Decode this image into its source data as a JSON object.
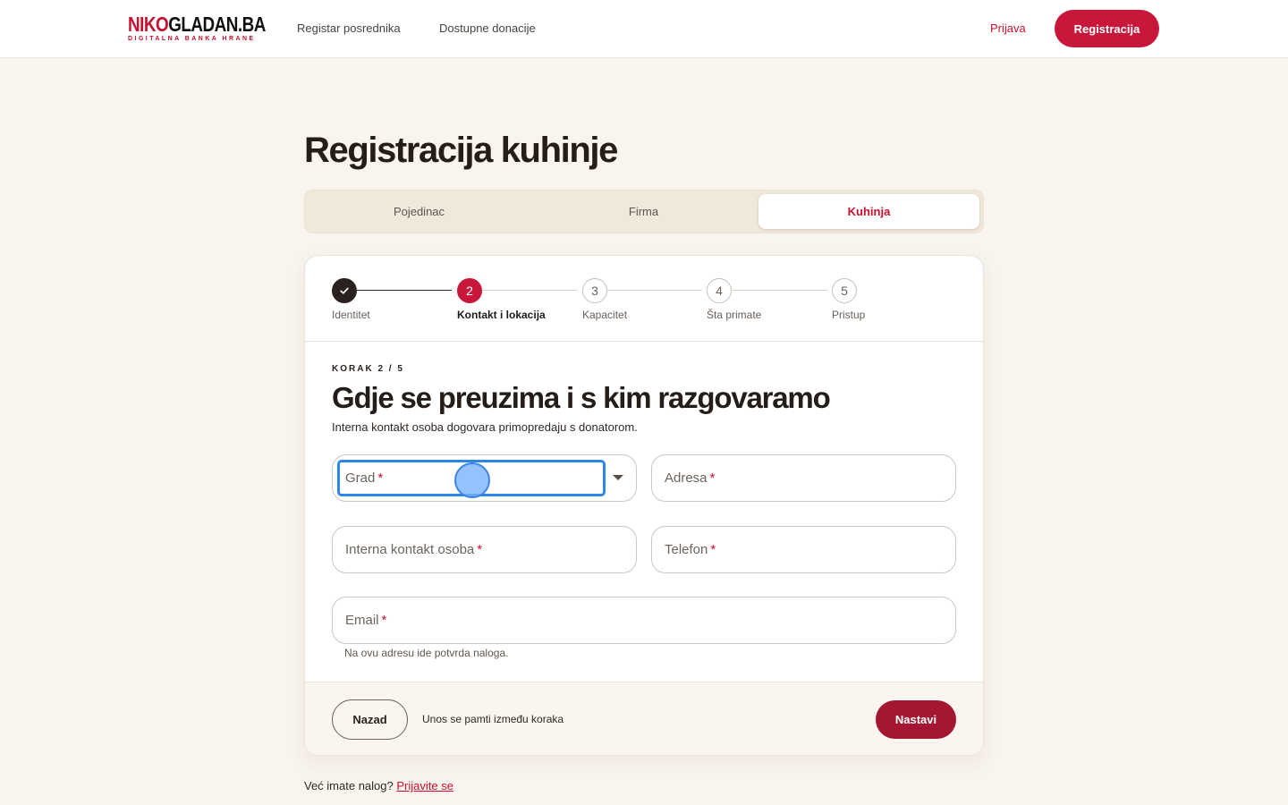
{
  "header": {
    "logo": {
      "part1": "NIKO",
      "part2": "GLADAN.BA",
      "tagline": "DIGITALNA BANKA HRANE"
    },
    "nav": [
      "Registar posrednika",
      "Dostupne donacije"
    ],
    "login": "Prijava",
    "register": "Registracija"
  },
  "page": {
    "title": "Registracija kuhinje"
  },
  "tabs": [
    "Pojedinac",
    "Firma",
    "Kuhinja"
  ],
  "active_tab": "Kuhinja",
  "stepper": {
    "current": 2,
    "total": 5,
    "steps": [
      {
        "num": "1",
        "label": "Identitet",
        "state": "done"
      },
      {
        "num": "2",
        "label": "Kontakt i lokacija",
        "state": "active"
      },
      {
        "num": "3",
        "label": "Kapacitet",
        "state": "upcoming"
      },
      {
        "num": "4",
        "label": "Šta primate",
        "state": "upcoming"
      },
      {
        "num": "5",
        "label": "Pristup",
        "state": "upcoming"
      }
    ]
  },
  "form": {
    "eyebrow": "KORAK 2 / 5",
    "title": "Gdje se preuzima i s kim razgovaramo",
    "description": "Interna kontakt osoba dogovara primopredaju s donatorom.",
    "required_mark": "*",
    "fields": {
      "grad": "Grad",
      "adresa": "Adresa",
      "kontakt": "Interna kontakt osoba",
      "telefon": "Telefon",
      "email": "Email"
    },
    "email_helper": "Na ovu adresu ide potvrda naloga."
  },
  "footer": {
    "back": "Nazad",
    "note": "Unos se pamti između koraka",
    "next": "Nastavi"
  },
  "bottom": {
    "text": "Već imate nalog?",
    "link": "Prijavite se"
  },
  "colors": {
    "brand_red": "#c8102e",
    "primary_button": "#c8173b",
    "next_button": "#a51633",
    "focus_ring": "#2d86e8",
    "page_background": "#f9f4ee"
  }
}
